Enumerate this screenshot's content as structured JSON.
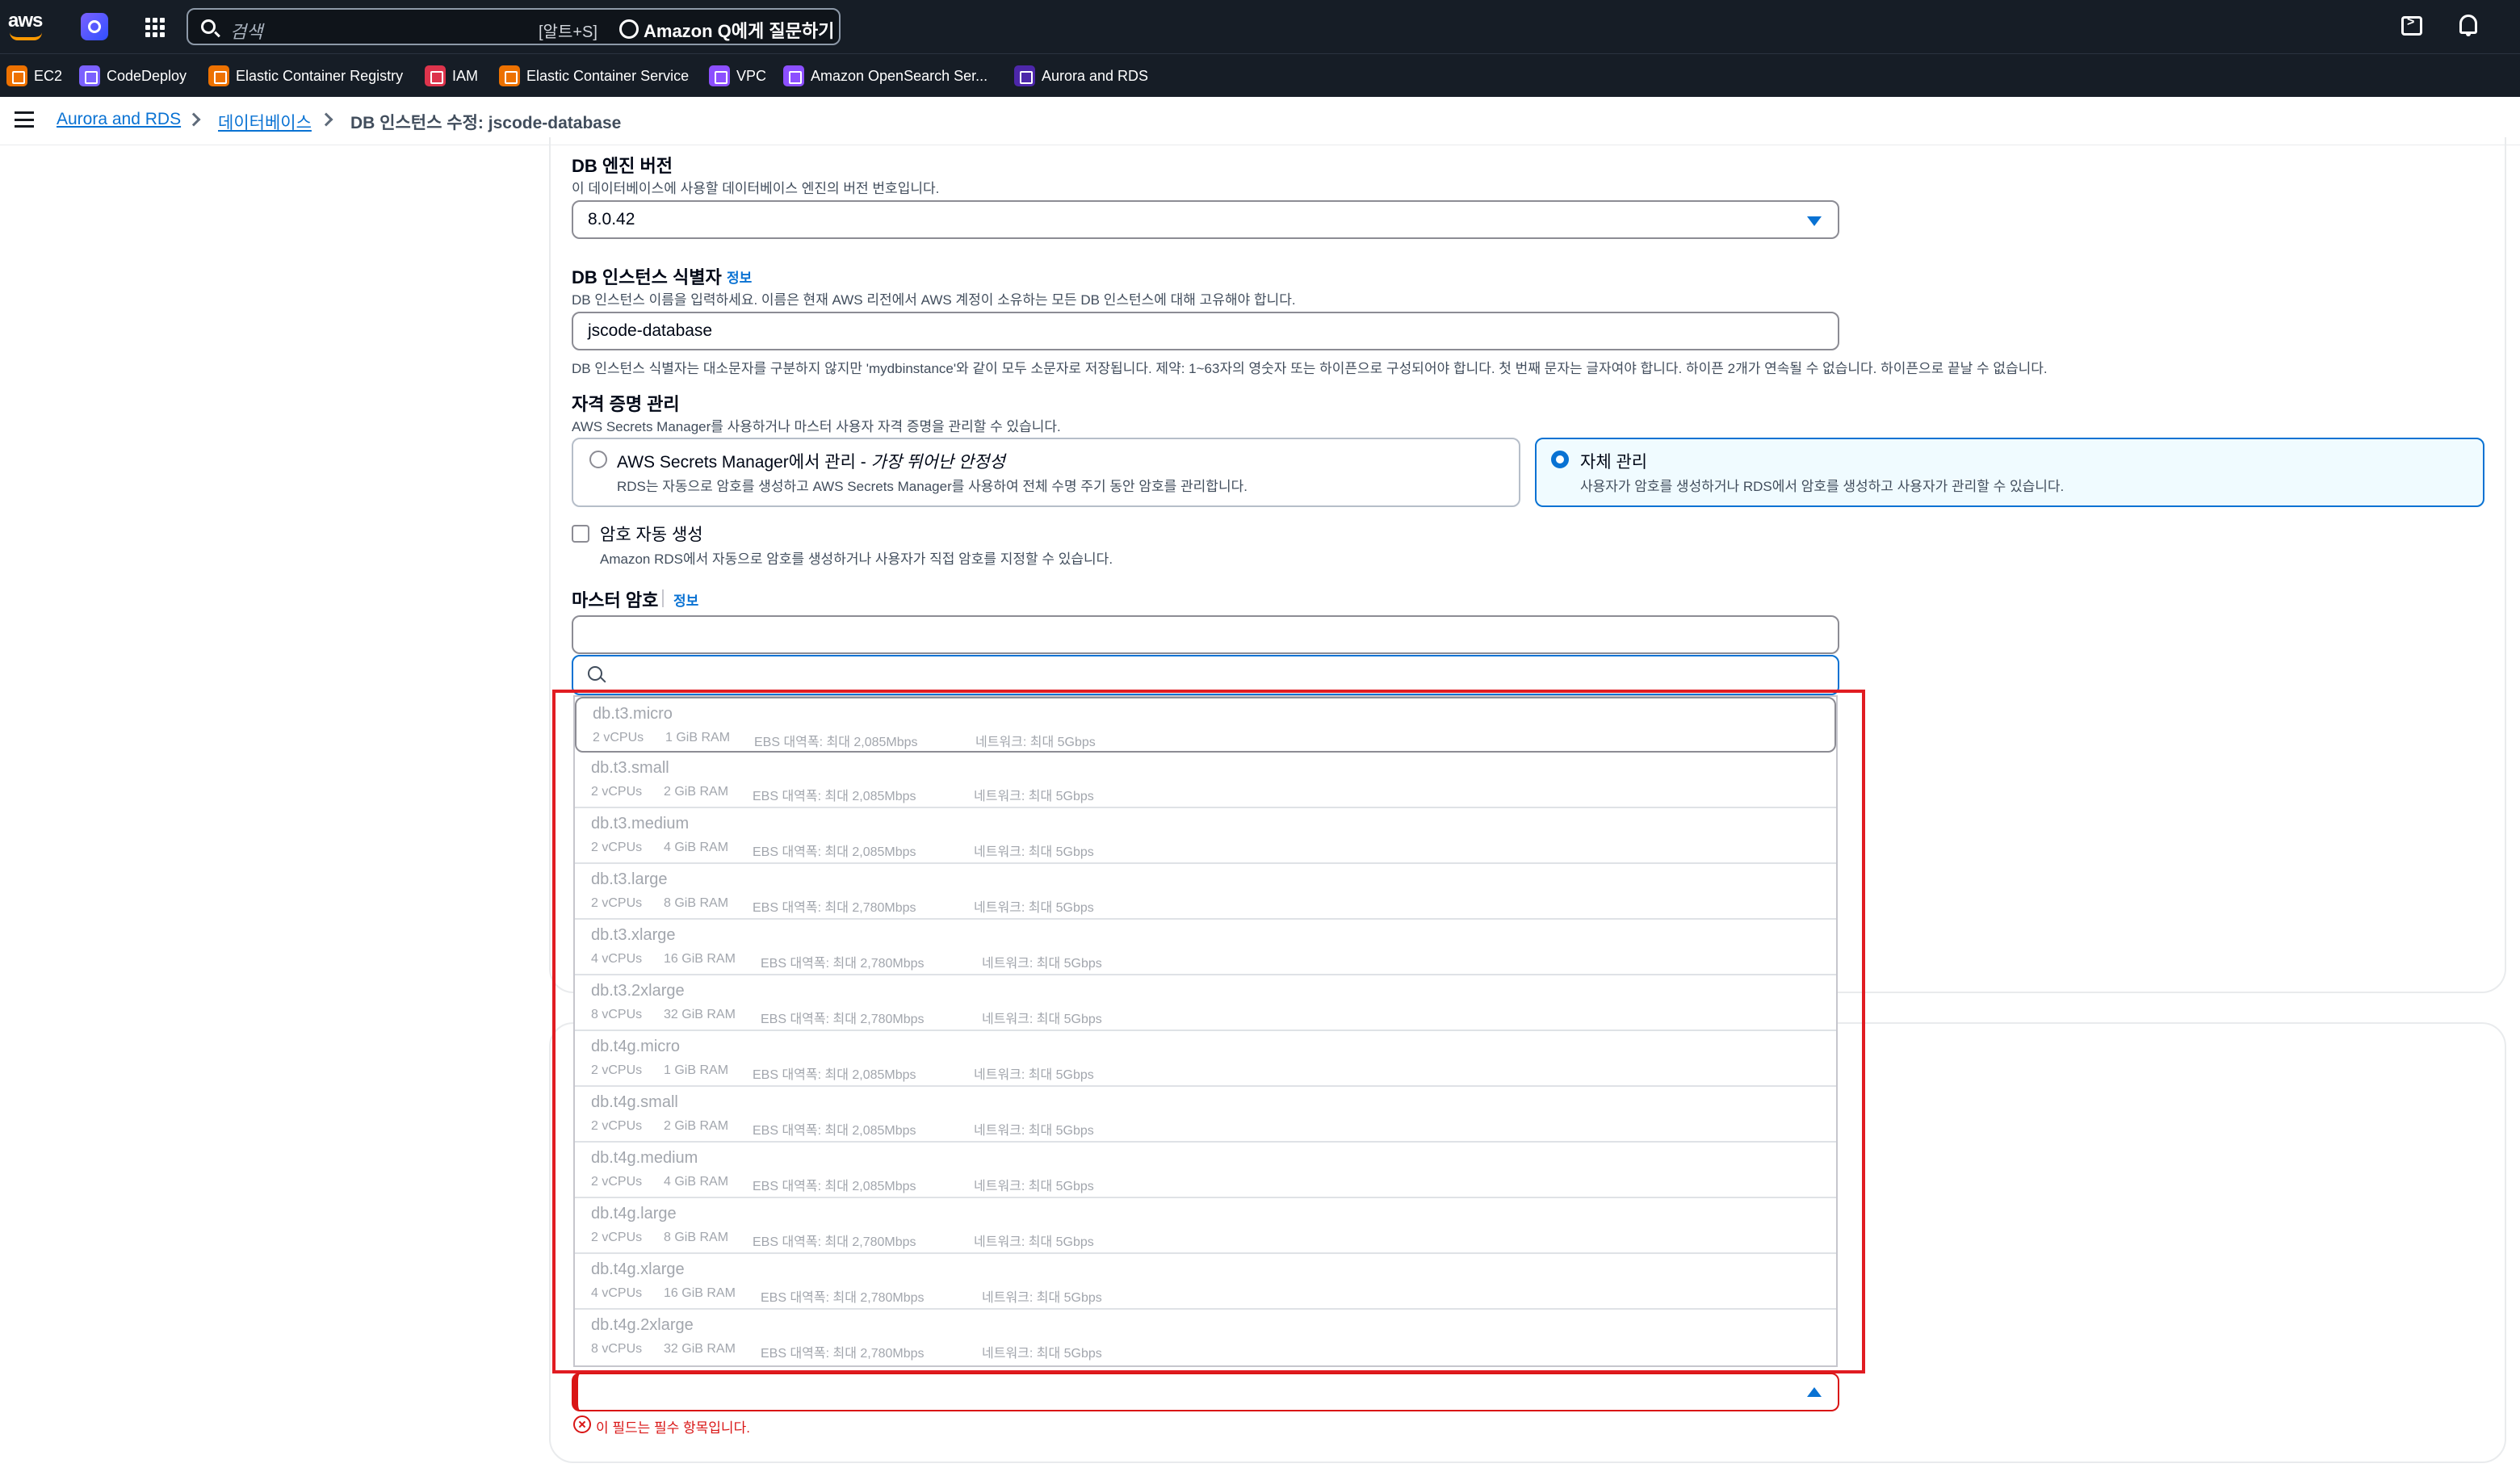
{
  "topnav": {
    "logo_text": "aws",
    "search_placeholder": "검색",
    "search_shortcut": "[알트+S]",
    "ask_q_label": "Amazon Q에게 질문하기"
  },
  "favorites": [
    {
      "label": "EC2",
      "color": "#ed7100"
    },
    {
      "label": "CodeDeploy",
      "color": "#7b61ff"
    },
    {
      "label": "Elastic Container Registry",
      "color": "#ed7100"
    },
    {
      "label": "IAM",
      "color": "#dd344c"
    },
    {
      "label": "Elastic Container Service",
      "color": "#ed7100"
    },
    {
      "label": "VPC",
      "color": "#8c4fff"
    },
    {
      "label": "Amazon OpenSearch Ser...",
      "color": "#8c4fff"
    },
    {
      "label": "Aurora and RDS",
      "color": "#4d27aa"
    }
  ],
  "breadcrumb": {
    "item1": "Aurora and RDS",
    "item2": "데이터베이스",
    "current": "DB 인스턴스 수정: jscode-database"
  },
  "engine_version": {
    "label": "DB 엔진 버전",
    "desc": "이 데이터베이스에 사용할 데이터베이스 엔진의 버전 번호입니다.",
    "value": "8.0.42"
  },
  "identifier": {
    "label": "DB 인스턴스 식별자",
    "info": "정보",
    "desc": "DB 인스턴스 이름을 입력하세요. 이름은 현재 AWS 리전에서 AWS 계정이 소유하는 모든 DB 인스턴스에 대해 고유해야 합니다.",
    "value": "jscode-database",
    "hint": "DB 인스턴스 식별자는 대소문자를 구분하지 않지만 'mydbinstance'와 같이 모두 소문자로 저장됩니다. 제약: 1~63자의 영숫자 또는 하이픈으로 구성되어야 합니다. 첫 번째 문자는 글자여야 합니다. 하이픈 2개가 연속될 수 없습니다. 하이픈으로 끝날 수 없습니다."
  },
  "credentials": {
    "label": "자격 증명 관리",
    "desc": "AWS Secrets Manager를 사용하거나 마스터 사용자 자격 증명을 관리할 수 있습니다.",
    "option1_title": "AWS Secrets Manager에서 관리 - ",
    "option1_emph": "가장 뛰어난 안정성",
    "option1_desc": "RDS는 자동으로 암호를 생성하고 AWS Secrets Manager를 사용하여 전체 수명 주기 동안 암호를 관리합니다.",
    "option2_title": "자체 관리",
    "option2_desc": "사용자가 암호를 생성하거나 RDS에서 암호를 생성하고 사용자가 관리할 수 있습니다."
  },
  "auto_password": {
    "label": "암호 자동 생성",
    "desc": "Amazon RDS에서 자동으로 암호를 생성하거나 사용자가 직접 암호를 지정할 수 있습니다."
  },
  "master_password": {
    "label": "마스터 암호",
    "info": "정보"
  },
  "instance_options": [
    {
      "name": "db.t3.micro",
      "vcpu": "2 vCPUs",
      "ram": "1 GiB RAM",
      "ebs": "EBS 대역폭: 최대 2,085Mbps",
      "net": "네트워크: 최대 5Gbps"
    },
    {
      "name": "db.t3.small",
      "vcpu": "2 vCPUs",
      "ram": "2 GiB RAM",
      "ebs": "EBS 대역폭: 최대 2,085Mbps",
      "net": "네트워크: 최대 5Gbps"
    },
    {
      "name": "db.t3.medium",
      "vcpu": "2 vCPUs",
      "ram": "4 GiB RAM",
      "ebs": "EBS 대역폭: 최대 2,085Mbps",
      "net": "네트워크: 최대 5Gbps"
    },
    {
      "name": "db.t3.large",
      "vcpu": "2 vCPUs",
      "ram": "8 GiB RAM",
      "ebs": "EBS 대역폭: 최대 2,780Mbps",
      "net": "네트워크: 최대 5Gbps"
    },
    {
      "name": "db.t3.xlarge",
      "vcpu": "4 vCPUs",
      "ram": "16 GiB RAM",
      "ebs": "EBS 대역폭: 최대 2,780Mbps",
      "net": "네트워크: 최대 5Gbps"
    },
    {
      "name": "db.t3.2xlarge",
      "vcpu": "8 vCPUs",
      "ram": "32 GiB RAM",
      "ebs": "EBS 대역폭: 최대 2,780Mbps",
      "net": "네트워크: 최대 5Gbps"
    },
    {
      "name": "db.t4g.micro",
      "vcpu": "2 vCPUs",
      "ram": "1 GiB RAM",
      "ebs": "EBS 대역폭: 최대 2,085Mbps",
      "net": "네트워크: 최대 5Gbps"
    },
    {
      "name": "db.t4g.small",
      "vcpu": "2 vCPUs",
      "ram": "2 GiB RAM",
      "ebs": "EBS 대역폭: 최대 2,085Mbps",
      "net": "네트워크: 최대 5Gbps"
    },
    {
      "name": "db.t4g.medium",
      "vcpu": "2 vCPUs",
      "ram": "4 GiB RAM",
      "ebs": "EBS 대역폭: 최대 2,085Mbps",
      "net": "네트워크: 최대 5Gbps"
    },
    {
      "name": "db.t4g.large",
      "vcpu": "2 vCPUs",
      "ram": "8 GiB RAM",
      "ebs": "EBS 대역폭: 최대 2,780Mbps",
      "net": "네트워크: 최대 5Gbps"
    },
    {
      "name": "db.t4g.xlarge",
      "vcpu": "4 vCPUs",
      "ram": "16 GiB RAM",
      "ebs": "EBS 대역폭: 최대 2,780Mbps",
      "net": "네트워크: 최대 5Gbps"
    },
    {
      "name": "db.t4g.2xlarge",
      "vcpu": "8 vCPUs",
      "ram": "32 GiB RAM",
      "ebs": "EBS 대역폭: 최대 2,780Mbps",
      "net": "네트워크: 최대 5Gbps"
    }
  ],
  "error_message": "이 필드는 필수 항목입니다.",
  "colors": {
    "nav_bg": "#161d26",
    "link": "#0972d3",
    "error": "#d91515",
    "highlight_box": "#e11c22"
  }
}
